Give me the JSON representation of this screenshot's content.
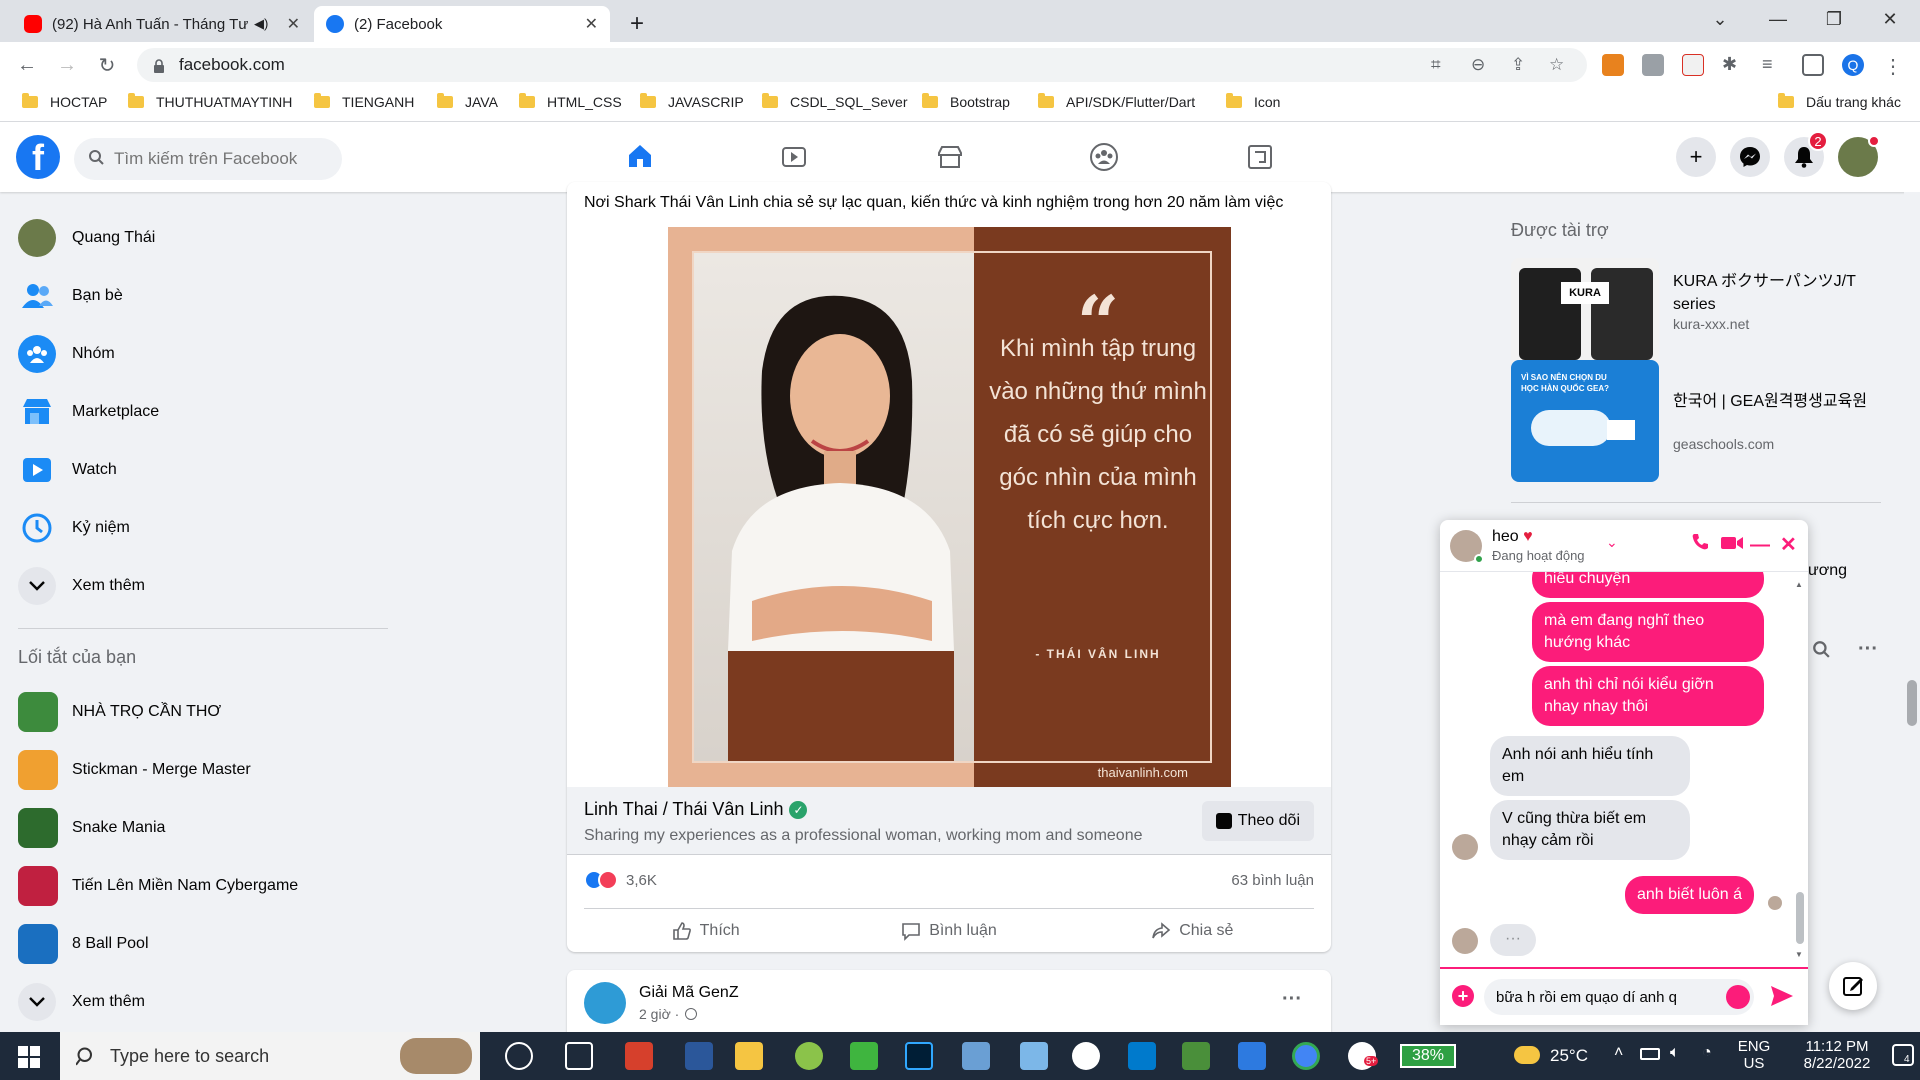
{
  "browser": {
    "tabs": [
      {
        "title": "(92) Hà Anh Tuấn - Tháng Tư",
        "color": "#ff0000"
      },
      {
        "title": "(2) Facebook",
        "color": "#1877f2"
      }
    ],
    "new_tab": "+",
    "url": "facebook.com",
    "bookmarks": [
      "HOCTAP",
      "THUTHUATMAYTINH",
      "TIENGANH",
      "JAVA",
      "HTML_CSS",
      "JAVASCRIP",
      "CSDL_SQL_Sever",
      "Bootstrap",
      "API/SDK/Flutter/Dart",
      "Icon"
    ],
    "other_bookmarks": "Dấu trang khác",
    "profile_initial": "Q"
  },
  "facebook": {
    "logo": "f",
    "search_placeholder": "Tìm kiếm trên Facebook",
    "notification_count": "2",
    "nav_tabs": [
      "home-icon",
      "watch-icon",
      "marketplace-icon",
      "groups-icon",
      "gaming-icon"
    ]
  },
  "sidebar": {
    "items": [
      {
        "label": "Quang Thái",
        "icon": "avatar"
      },
      {
        "label": "Bạn bè",
        "icon": "friends-icon"
      },
      {
        "label": "Nhóm",
        "icon": "groups-icon"
      },
      {
        "label": "Marketplace",
        "icon": "marketplace-icon"
      },
      {
        "label": "Watch",
        "icon": "watch-icon"
      },
      {
        "label": "Kỷ niệm",
        "icon": "memories-icon"
      },
      {
        "label": "Xem thêm",
        "icon": "chevron-down-icon"
      }
    ],
    "shortcuts_heading": "Lối tắt của bạn",
    "shortcuts": [
      {
        "label": "NHÀ TRỌ CẦN THƠ",
        "color": "#3d8b3d"
      },
      {
        "label": "Stickman - Merge Master",
        "color": "#f0a030"
      },
      {
        "label": "Snake Mania",
        "color": "#2d6b2d"
      },
      {
        "label": "Tiến Lên Miền Nam Cybergame",
        "color": "#c02040"
      },
      {
        "label": "8 Ball Pool",
        "color": "#1a6fc0"
      }
    ],
    "more_label": "Xem thêm"
  },
  "post": {
    "text": "Nơi Shark Thái Vân Linh chia sẻ sự lạc quan, kiến thức và kinh nghiệm trong hơn 20 năm làm việc",
    "image": {
      "quote_mark": "“",
      "quote": "Khi mình tập trung vào những thứ mình đã có sẽ giúp cho góc nhìn của mình tích cực hơn.",
      "author": "- THÁI VÂN LINH",
      "site": "thaivanlinh.com"
    },
    "page_name": "Linh Thai / Thái Vân Linh",
    "verified_mark": "✓",
    "page_desc": "Sharing my experiences as a professional woman, working mom and someone",
    "follow_label": "Theo dõi",
    "reactions": "3,6K",
    "comments": "63 bình luận",
    "actions": [
      "Thích",
      "Bình luận",
      "Chia sẻ"
    ]
  },
  "post2": {
    "author": "Giải Mã GenZ",
    "time": "2 giờ ·",
    "more": "···"
  },
  "sponsored": {
    "heading": "Được tài trợ",
    "ads": [
      {
        "title": "KURA ボクサーパンツJ/T series",
        "url": "kura-xxx.net",
        "img_text": "KURA"
      },
      {
        "title": "한국어 | GEA원격평생교육원",
        "url": "geaschools.com",
        "img_text": "VÌ SAO NÊN CHỌN DU HỌC HÀN QUỐC GEA?"
      }
    ],
    "partial_text": "ương"
  },
  "chat": {
    "name": "heo",
    "heart": "♥",
    "status": "Đang hoạt động",
    "messages": [
      {
        "text": "hiểu chuyện",
        "dir": "out"
      },
      {
        "text": "mà em đang nghĩ theo hướng khác",
        "dir": "out"
      },
      {
        "text": "anh thì chỉ nói kiểu giỡn nhay nhay thôi",
        "dir": "out"
      },
      {
        "text": "Anh nói anh hiểu tính em",
        "dir": "in"
      },
      {
        "text": "V cũng thừa biết em nhạy cảm rồi",
        "dir": "in"
      },
      {
        "text": "anh biết luôn á",
        "dir": "out"
      },
      {
        "text": "···",
        "dir": "in"
      }
    ],
    "draft": "bữa h rồi em quạo dí anh q",
    "accent": "#fc1c7a"
  },
  "taskbar": {
    "search_placeholder": "Type here to search",
    "battery": "38%",
    "weather": "25°C",
    "lang": "ENG",
    "region": "US",
    "time": "11:12 PM",
    "date": "8/22/2022",
    "notif_count": "4",
    "zalo_badge": "5+"
  }
}
